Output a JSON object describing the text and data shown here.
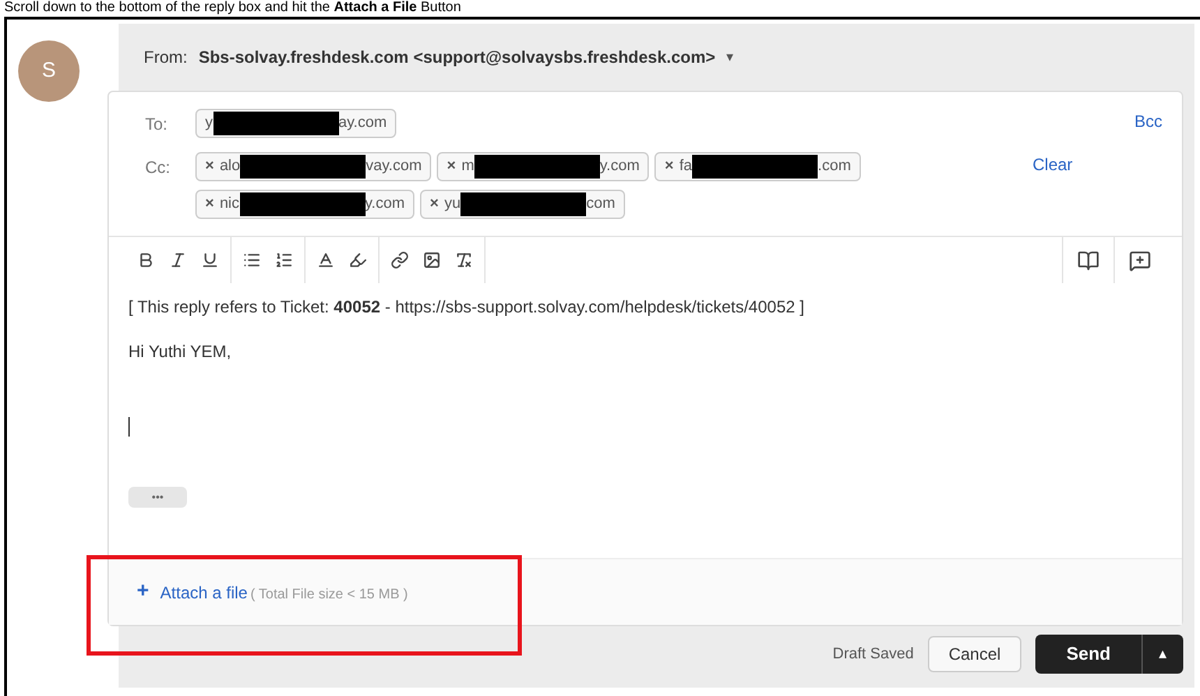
{
  "caption": "Scroll down to the bottom of the reply box and hit the **Attach a File** Button",
  "avatar": {
    "letter": "S"
  },
  "from": {
    "label": "From:",
    "value": "Sbs-solvay.freshdesk.com <support@solvaysbs.freshdesk.com>",
    "caret": "▾"
  },
  "to": {
    "label": "To:",
    "chips": [
      {
        "prefix": "y",
        "suffix": "ay.com"
      }
    ]
  },
  "bcc": "Bcc",
  "cc": {
    "label": "Cc:",
    "chips": [
      {
        "remove": "×",
        "prefix": "alo",
        "suffix": "vay.com"
      },
      {
        "remove": "×",
        "prefix": "m",
        "suffix": "y.com"
      },
      {
        "remove": "×",
        "prefix": "fa",
        "suffix": ".com"
      },
      {
        "remove": "×",
        "prefix": "nic",
        "suffix": "y.com"
      },
      {
        "remove": "×",
        "prefix": "yu",
        "suffix": "com"
      }
    ]
  },
  "clear": "Clear",
  "body": {
    "ticket_line": "[ This reply refers to Ticket: **40052** - https://sbs-support.solvay.com/helpdesk/tickets/40052 ]",
    "greeting": "Hi Yuthi YEM,",
    "more": "•••"
  },
  "attach": {
    "icon": "+",
    "link": "Attach a file",
    "note": "( Total File size < 15 MB )"
  },
  "footer": {
    "status": "Draft Saved",
    "cancel": "Cancel",
    "send": "Send",
    "send_menu": "▴"
  }
}
